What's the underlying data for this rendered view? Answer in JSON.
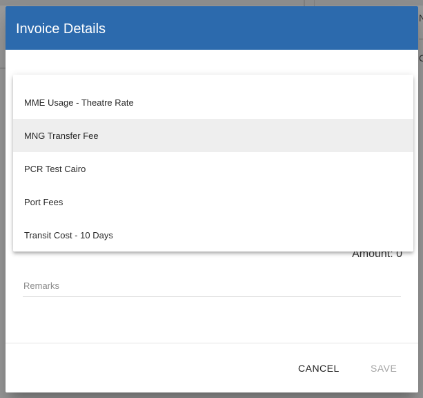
{
  "dialog": {
    "title": "Invoice Details",
    "header_color": "#2c6aad"
  },
  "amount": {
    "label": "Amount: 0"
  },
  "remarks": {
    "placeholder": "Remarks",
    "value": ""
  },
  "menu": {
    "items": [
      {
        "label": "MME Usage - Theatre Rate",
        "highlighted": false
      },
      {
        "label": "MNG Transfer Fee",
        "highlighted": true
      },
      {
        "label": "PCR Test Cairo",
        "highlighted": false
      },
      {
        "label": "Port Fees",
        "highlighted": false
      },
      {
        "label": "Transit Cost - 10 Days",
        "highlighted": false
      }
    ]
  },
  "actions": {
    "cancel_label": "CANCEL",
    "save_label": "SAVE"
  },
  "background": {
    "edge_glyph_1": "N",
    "edge_glyph_2": "C"
  }
}
